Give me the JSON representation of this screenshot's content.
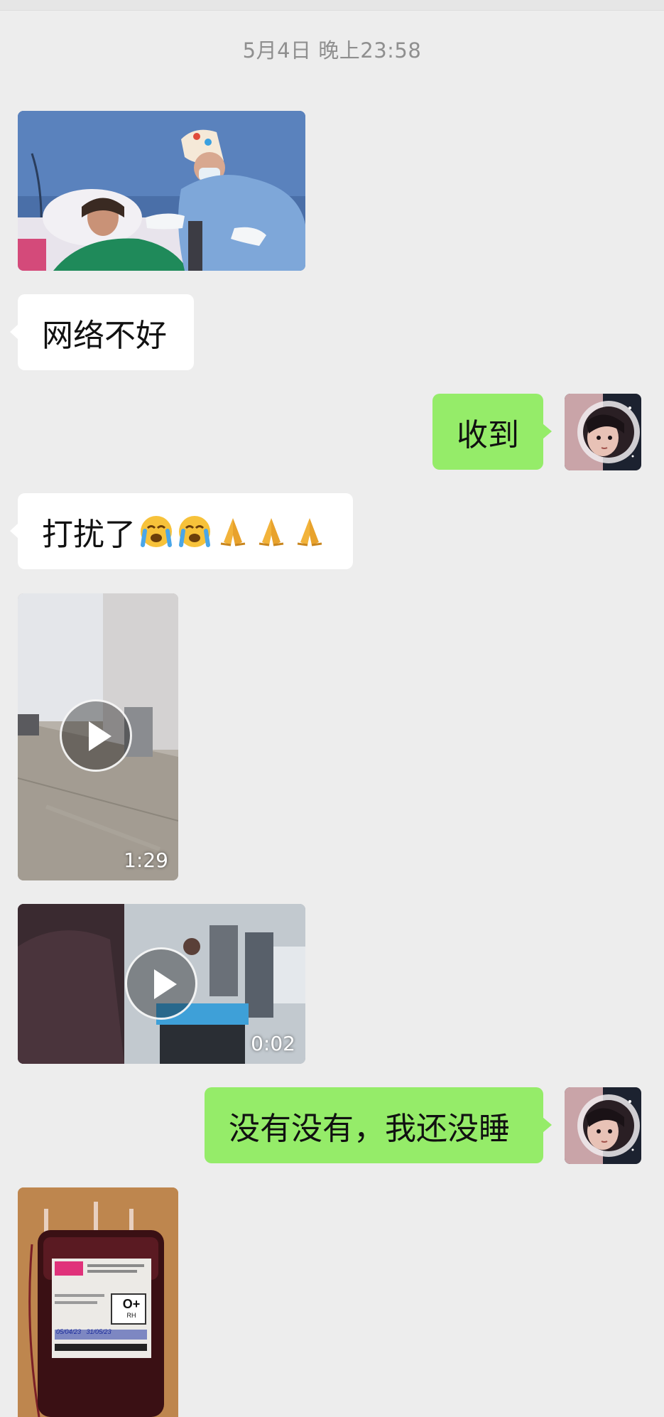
{
  "timestamp": "5月4日 晚上23:58",
  "messages": {
    "m1_image": {
      "desc": "hospital bed photo"
    },
    "m2_text": "网络不好",
    "m3_text": "收到",
    "m4_text": "打扰了",
    "m4_emojis": [
      "loudly-crying-face",
      "loudly-crying-face",
      "folded-hands",
      "folded-hands",
      "folded-hands"
    ],
    "m5_video": {
      "duration": "1:29"
    },
    "m6_video": {
      "duration": "0:02"
    },
    "m7_text": "没有没有，我还没睡",
    "m8_image": {
      "label_code": "O+",
      "label_sub": "RH",
      "label_dates": "05/04/23   31/05/23"
    }
  },
  "colors": {
    "background": "#ededed",
    "sent_bubble": "#95ec69",
    "received_bubble": "#ffffff",
    "timestamp_text": "#8f8f8f"
  }
}
